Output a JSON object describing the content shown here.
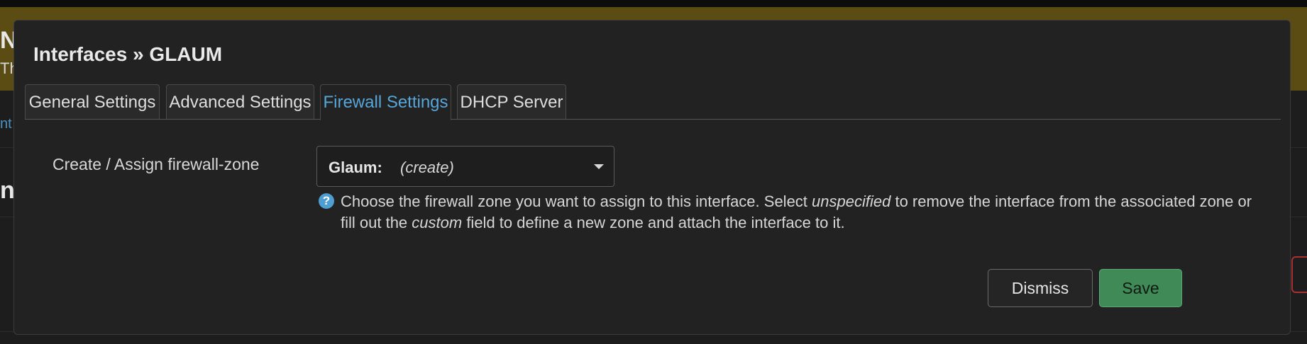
{
  "background": {
    "alert_edge_title": "N",
    "alert_edge_text": "Th",
    "link_edge": "nt",
    "heading_edge": "nt"
  },
  "modal": {
    "title": "Interfaces » GLAUM",
    "tabs": [
      {
        "label": "General Settings",
        "active": false
      },
      {
        "label": "Advanced Settings",
        "active": false
      },
      {
        "label": "Firewall Settings",
        "active": true
      },
      {
        "label": "DHCP Server",
        "active": false
      }
    ],
    "field": {
      "label": "Create / Assign firewall-zone",
      "select_name": "Glaum:",
      "select_hint": "(create)"
    },
    "help": {
      "icon": "question-circle-icon",
      "part1": "Choose the firewall zone you want to assign to this interface. Select ",
      "em1": "unspecified",
      "part2": " to remove the interface from the associated zone or fill out the ",
      "em2": "custom",
      "part3": " field to define a new zone and attach the interface to it."
    },
    "buttons": {
      "dismiss": "Dismiss",
      "save": "Save"
    }
  },
  "colors": {
    "accent": "#56a6d9",
    "save_green": "#3f8a57",
    "alert_bg": "#5a4c12"
  }
}
